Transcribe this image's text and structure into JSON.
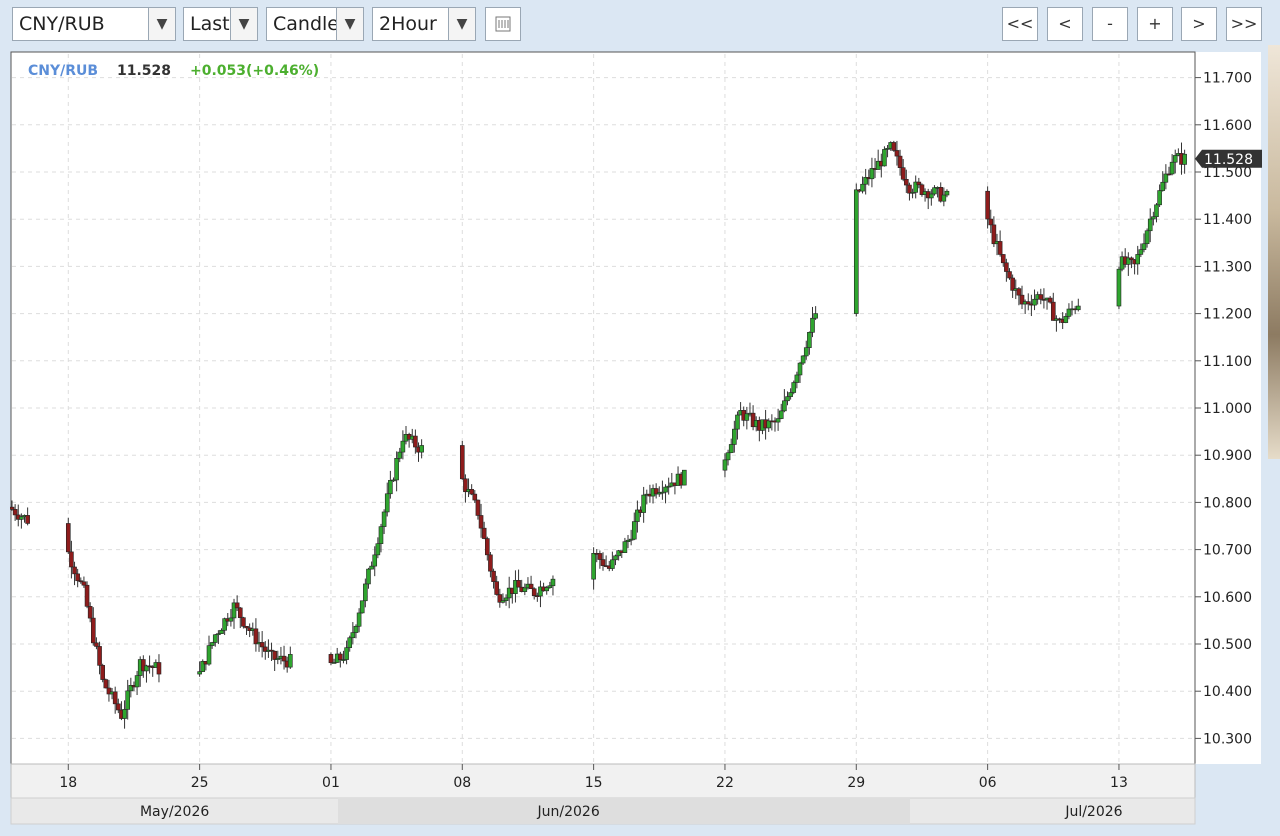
{
  "toolbar": {
    "symbol": "CNY/RUB",
    "price_type": "Last",
    "chart_style": "Candle",
    "interval": "2Hour",
    "dropdown_glyph": "▼",
    "indicator_icon": "chart-settings-icon",
    "nav": {
      "first": "<<",
      "prev": "<",
      "zoom_out": "-",
      "zoom_in": "+",
      "next": ">",
      "last": ">>"
    }
  },
  "header": {
    "symbol": "CNY/RUB",
    "price": "11.528",
    "change": "+0.053(+0.46%)"
  },
  "colors": {
    "up": "#2fa52f",
    "down": "#8e1c1c",
    "symbol_label": "#5b8ed8",
    "change_label": "#4caf2f",
    "grid": "#dddddd"
  },
  "chart_data": {
    "type": "candlestick",
    "title": "CNY/RUB",
    "interval": "2Hour",
    "last_price": 11.528,
    "change": 0.053,
    "change_pct": 0.46,
    "ylim": [
      10.25,
      11.75
    ],
    "y_ticks": [
      "10.300",
      "10.400",
      "10.500",
      "10.600",
      "10.700",
      "10.800",
      "10.900",
      "11.000",
      "11.100",
      "11.200",
      "11.300",
      "11.400",
      "11.500",
      "11.600",
      "11.700"
    ],
    "x_ticks": [
      "18",
      "25",
      "01",
      "08",
      "15",
      "22",
      "29",
      "06",
      "13"
    ],
    "months": [
      "May/2026",
      "Jun/2026",
      "Jul/2026"
    ],
    "grid": true,
    "daily_closes": [
      [
        "2026-05-15",
        10.79
      ],
      [
        "2026-05-18",
        10.71
      ],
      [
        "2026-05-19",
        10.61
      ],
      [
        "2026-05-20",
        10.42
      ],
      [
        "2026-05-21",
        10.35
      ],
      [
        "2026-05-22",
        10.46
      ],
      [
        "2026-05-25",
        10.42
      ],
      [
        "2026-05-26",
        10.52
      ],
      [
        "2026-05-27",
        10.58
      ],
      [
        "2026-05-28",
        10.52
      ],
      [
        "2026-05-29",
        10.47
      ],
      [
        "2026-06-01",
        10.45
      ],
      [
        "2026-06-02",
        10.48
      ],
      [
        "2026-06-03",
        10.62
      ],
      [
        "2026-06-04",
        10.78
      ],
      [
        "2026-06-05",
        10.94
      ],
      [
        "2026-06-08",
        10.86
      ],
      [
        "2026-06-09",
        10.78
      ],
      [
        "2026-06-10",
        10.6
      ],
      [
        "2026-06-11",
        10.62
      ],
      [
        "2026-06-12",
        10.61
      ],
      [
        "2026-06-15",
        10.7
      ],
      [
        "2026-06-16",
        10.66
      ],
      [
        "2026-06-17",
        10.72
      ],
      [
        "2026-06-18",
        10.82
      ],
      [
        "2026-06-19",
        10.84
      ],
      [
        "2026-06-22",
        10.88
      ],
      [
        "2026-06-23",
        10.99
      ],
      [
        "2026-06-24",
        10.96
      ],
      [
        "2026-06-25",
        10.97
      ],
      [
        "2026-06-26",
        11.08
      ],
      [
        "2026-06-29",
        11.44
      ],
      [
        "2026-06-30",
        11.5
      ],
      [
        "2026-07-01",
        11.55
      ],
      [
        "2026-07-02",
        11.47
      ],
      [
        "2026-07-03",
        11.46
      ],
      [
        "2026-07-06",
        11.42
      ],
      [
        "2026-07-07",
        11.3
      ],
      [
        "2026-07-08",
        11.22
      ],
      [
        "2026-07-09",
        11.24
      ],
      [
        "2026-07-10",
        11.18
      ],
      [
        "2026-07-13",
        11.31
      ],
      [
        "2026-07-14",
        11.3
      ],
      [
        "2026-07-15",
        11.42
      ],
      [
        "2026-07-16",
        11.528
      ]
    ]
  }
}
